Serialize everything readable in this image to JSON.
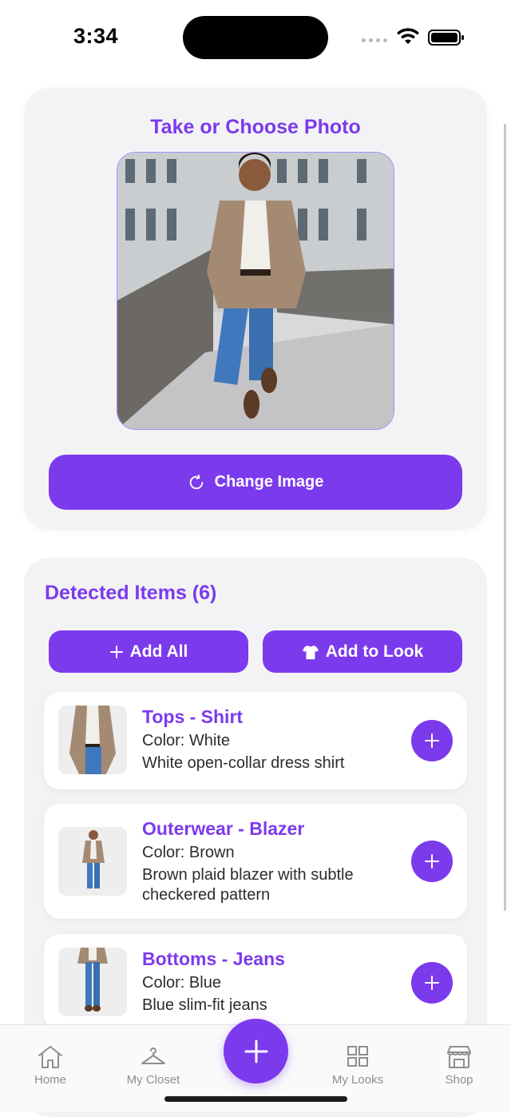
{
  "status_bar": {
    "time": "3:34"
  },
  "photo_section": {
    "title": "Take or Choose Photo",
    "change_button_label": "Change Image"
  },
  "detected": {
    "title": "Detected Items (6)",
    "add_all_label": "Add All",
    "add_to_look_label": "Add to Look",
    "items": [
      {
        "title": "Tops - Shirt",
        "color": "Color: White",
        "description": "White open-collar dress shirt"
      },
      {
        "title": "Outerwear - Blazer",
        "color": "Color: Brown",
        "description": "Brown plaid blazer with subtle checkered pattern"
      },
      {
        "title": "Bottoms - Jeans",
        "color": "Color: Blue",
        "description": "Blue slim-fit jeans"
      }
    ]
  },
  "tab_bar": {
    "tabs": [
      {
        "label": "Home",
        "icon": "home-icon"
      },
      {
        "label": "My Closet",
        "icon": "hanger-icon"
      },
      {
        "label": "My Looks",
        "icon": "grid-icon"
      },
      {
        "label": "Shop",
        "icon": "store-icon"
      }
    ]
  },
  "colors": {
    "accent": "#7c3aed",
    "card_bg": "#f3f3f6",
    "tab_inactive": "#8e8e93"
  }
}
